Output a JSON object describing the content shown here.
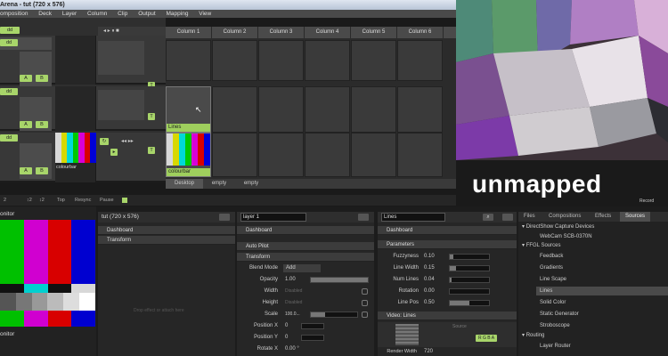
{
  "window": {
    "title": "Arena - tut (720 x 576)"
  },
  "menu": [
    "omposition",
    "Deck",
    "Layer",
    "Column",
    "Clip",
    "Output",
    "Mapping",
    "View"
  ],
  "left": {
    "add_label": "dd",
    "a_label": "A",
    "b_label": "B",
    "ops": [
      "off",
      "B",
      "B"
    ],
    "clip_label": "colourbar",
    "dsh": "dph"
  },
  "columns": [
    "Column 1",
    "Column 2",
    "Column 3",
    "Column 4",
    "Column 5",
    "Column 6"
  ],
  "grid": {
    "clip_lines": "Lines",
    "clip_colourbar": "colourbar"
  },
  "deck_tabs": [
    "Desktop",
    "empty",
    "empty"
  ],
  "toolbar": {
    "items": [
      "2",
      "↕2",
      "↕2",
      "Top",
      "Resync",
      "Pause"
    ]
  },
  "overlay": {
    "text": "unmapped",
    "record": "Record"
  },
  "colors": {
    "accent": "#a8d56a",
    "panel": "#2e2e2e"
  },
  "monitor": {
    "title": "onitor",
    "bottom_label": "onitor"
  },
  "composition": {
    "title": "tut (720 x 576)",
    "sections": [
      "Dashboard",
      "Transform"
    ],
    "drop_hint": "Drop effect or attach here"
  },
  "layer": {
    "name_value": "layer 1",
    "sections": {
      "dashboard": "Dashboard",
      "autopilot": "Auto Pilot",
      "transform": "Transform"
    },
    "params": [
      {
        "label": "Blend Mode",
        "value": "Add"
      },
      {
        "label": "Opacity",
        "value": "1.00"
      },
      {
        "label": "Width",
        "value": "Disabled"
      },
      {
        "label": "Height",
        "value": "Disabled"
      },
      {
        "label": "Scale",
        "value": "100.0..."
      },
      {
        "label": "Position X",
        "value": "0"
      },
      {
        "label": "Position Y",
        "value": "0"
      },
      {
        "label": "Rotate X",
        "value": "0.00 °"
      }
    ]
  },
  "clip": {
    "name_value": "Lines",
    "sections": {
      "dashboard": "Dashboard",
      "parameters": "Parameters",
      "video": "Video: Lines"
    },
    "params": [
      {
        "label": "Fuzzyness",
        "value": "0.10"
      },
      {
        "label": "Line Width",
        "value": "0.15"
      },
      {
        "label": "Num Lines",
        "value": "0.04"
      },
      {
        "label": "Rotation",
        "value": "0.00"
      },
      {
        "label": "Line Pos",
        "value": "0.50"
      }
    ],
    "render_label": "Render Width",
    "render_value": "720",
    "sizing": "Source"
  },
  "browser": {
    "tabs": [
      "Files",
      "Compositions",
      "Effects",
      "Sources"
    ],
    "tree": [
      {
        "text": "DirectShow Capture Devices",
        "level": 0
      },
      {
        "text": "WebCam SCB-0370N",
        "level": 2
      },
      {
        "text": "FFGL Sources",
        "level": 0
      },
      {
        "text": "Feedback",
        "level": 2
      },
      {
        "text": "Gradients",
        "level": 2
      },
      {
        "text": "Line Scape",
        "level": 2
      },
      {
        "text": "Lines",
        "level": 2
      },
      {
        "text": "Solid Color",
        "level": 2
      },
      {
        "text": "Static Generator",
        "level": 2
      },
      {
        "text": "Stroboscope",
        "level": 2
      },
      {
        "text": "Routing",
        "level": 0
      },
      {
        "text": "Layer Router",
        "level": 2
      }
    ]
  }
}
